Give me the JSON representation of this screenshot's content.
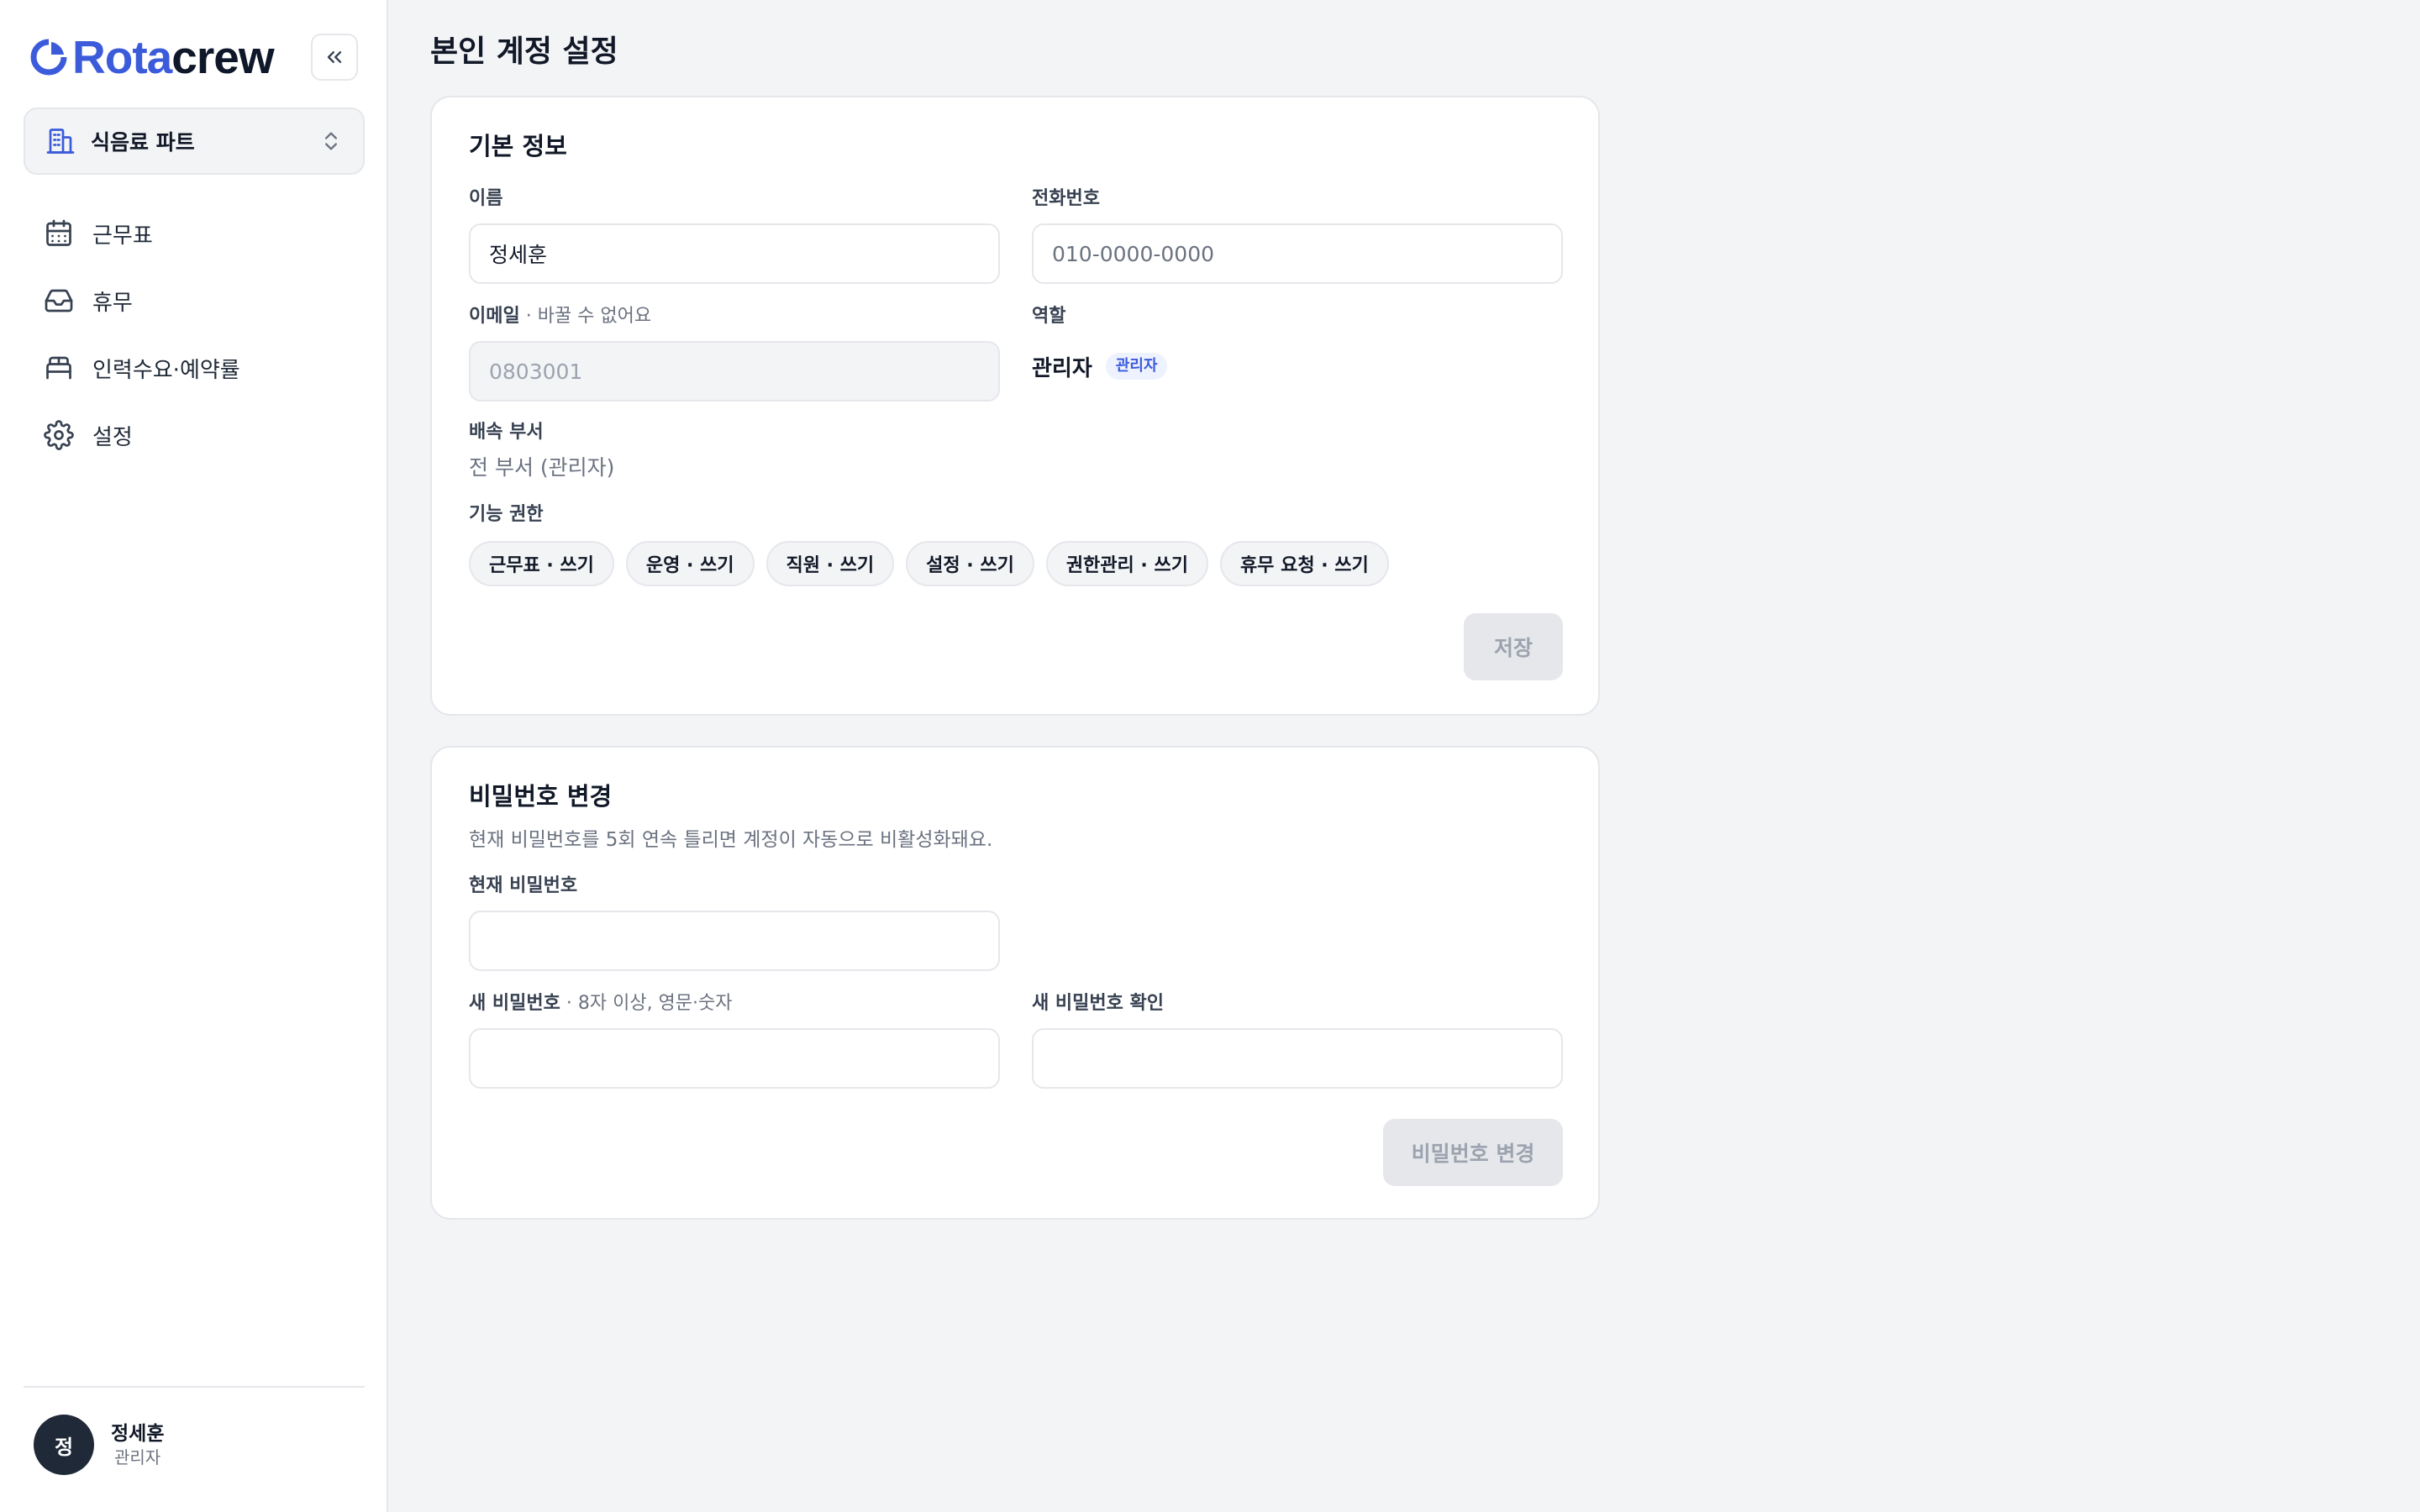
{
  "brand": {
    "name_a": "Rota",
    "name_b": "crew",
    "accent": "#3b5bdb"
  },
  "sidebar": {
    "collapse_icon": "chevrons-left-icon",
    "team": {
      "label": "식음료 파트",
      "icon": "building-icon"
    },
    "items": [
      {
        "label": "근무표",
        "icon": "calendar-icon"
      },
      {
        "label": "휴무",
        "icon": "inbox-icon"
      },
      {
        "label": "인력수요·예약률",
        "icon": "bed-icon"
      },
      {
        "label": "설정",
        "icon": "gear-icon"
      }
    ],
    "user": {
      "initial": "정",
      "name": "정세훈",
      "role": "관리자"
    }
  },
  "page": {
    "title": "본인 계정 설정"
  },
  "basic": {
    "title": "기본 정보",
    "name_label": "이름",
    "name_value": "정세훈",
    "phone_label": "전화번호",
    "phone_placeholder": "010-0000-0000",
    "email_label": "이메일",
    "email_hint": " · 바꿀 수 없어요",
    "email_value": "0803001",
    "role_label": "역할",
    "role_value": "관리자",
    "role_badge": "관리자",
    "dept_label": "배속 부서",
    "dept_value": "전 부서 (관리자)",
    "perm_label": "기능 권한",
    "permissions": [
      "근무표 · 쓰기",
      "운영 · 쓰기",
      "직원 · 쓰기",
      "설정 · 쓰기",
      "권한관리 · 쓰기",
      "휴무 요청 · 쓰기"
    ],
    "save_label": "저장"
  },
  "password": {
    "title": "비밀번호 변경",
    "description": "현재 비밀번호를 5회 연속 틀리면 계정이 자동으로 비활성화돼요.",
    "current_label": "현재 비밀번호",
    "new_label": "새 비밀번호",
    "new_hint": " · 8자 이상, 영문·숫자",
    "confirm_label": "새 비밀번호 확인",
    "submit_label": "비밀번호 변경"
  }
}
